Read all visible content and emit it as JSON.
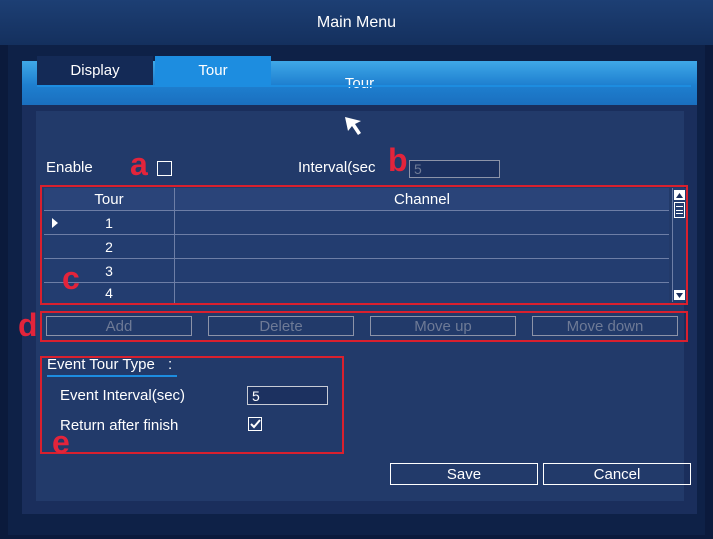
{
  "window": {
    "title": "Main Menu"
  },
  "dialog": {
    "title": "Tour"
  },
  "tabs": [
    {
      "label": "Display",
      "active": false
    },
    {
      "label": "Tour",
      "active": true
    }
  ],
  "enable": {
    "label": "Enable",
    "checked": false
  },
  "interval": {
    "label": "Interval(sec",
    "value": "5"
  },
  "table": {
    "headers": [
      "Tour",
      "Channel"
    ],
    "rows": [
      {
        "tour": "1",
        "channel": ""
      },
      {
        "tour": "2",
        "channel": ""
      },
      {
        "tour": "3",
        "channel": ""
      },
      {
        "tour": "4",
        "channel": ""
      }
    ]
  },
  "actions": {
    "add": "Add",
    "delete": "Delete",
    "move_up": "Move up",
    "move_down": "Move down"
  },
  "event_tour": {
    "title": "Event Tour Type",
    "colon": ":",
    "interval_label": "Event Interval(sec)",
    "interval_value": "5",
    "return_label": "Return after finish",
    "return_checked": true
  },
  "footer": {
    "save": "Save",
    "cancel": "Cancel"
  },
  "markers": {
    "a": "a",
    "b": "b",
    "c": "c",
    "d": "d",
    "e": "e"
  },
  "colors": {
    "accent": "#1d8de0",
    "annotation": "#d9202e",
    "background": "#1a2e5c"
  },
  "icons": {
    "cursor": "cursor-arrow-icon",
    "check": "checkmark-icon",
    "scroll_up": "scroll-up-icon",
    "scroll_down": "scroll-down-icon",
    "row_pointer": "row-pointer-icon"
  }
}
